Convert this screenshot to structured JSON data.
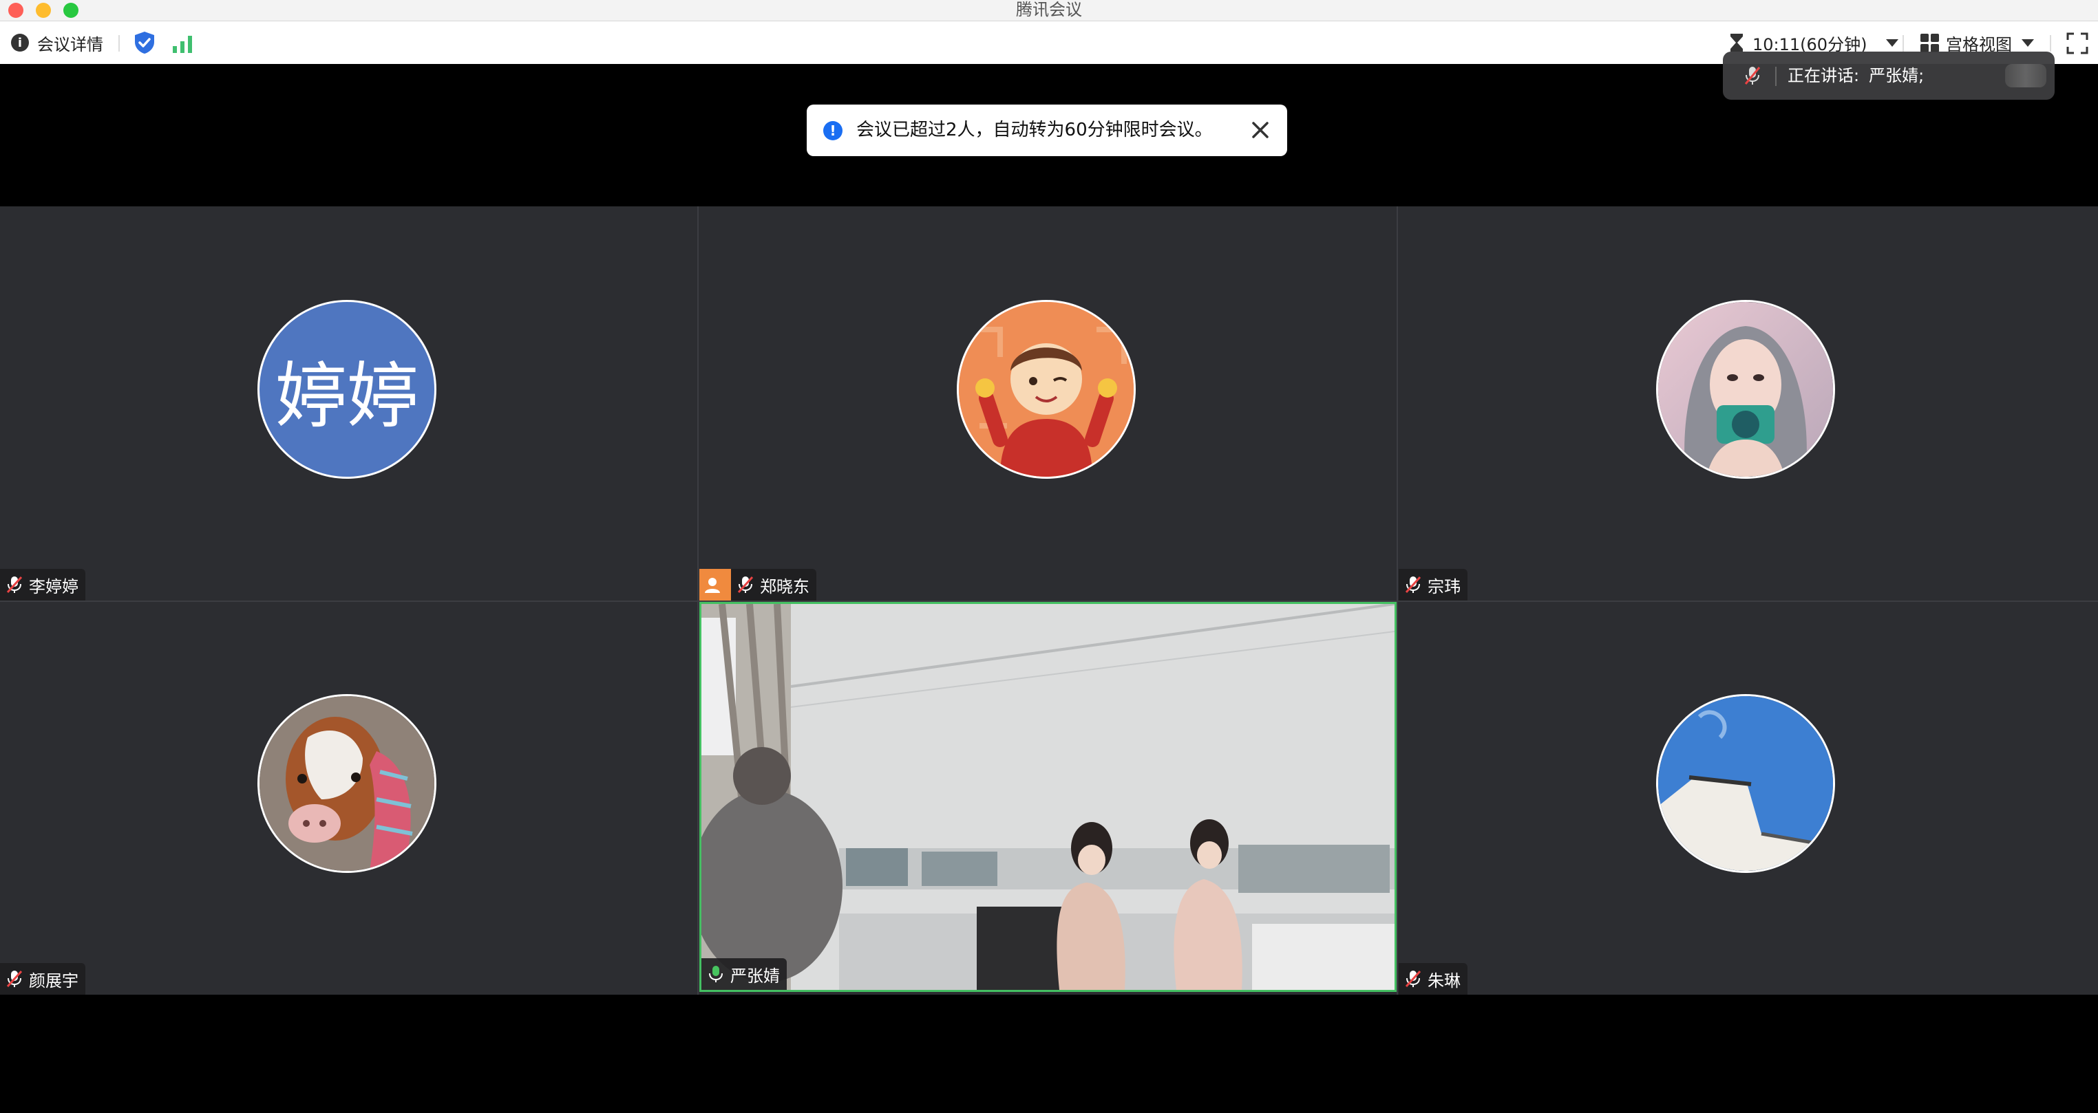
{
  "window": {
    "title": "腾讯会议"
  },
  "toolbar": {
    "meeting_info_label": "会议详情",
    "timer_label": "10:11(60分钟)",
    "view_label": "宫格视图"
  },
  "speaking_bar": {
    "prefix": "正在讲话:",
    "speaker": "严张婧;"
  },
  "toast": {
    "message": "会议已超过2人，自动转为60分钟限时会议。"
  },
  "participants": [
    {
      "name": "李婷婷",
      "avatar_text": "婷婷",
      "mic": "muted",
      "avatar_color": "#4f76c0"
    },
    {
      "name": "郑晓东",
      "mic": "muted",
      "host_badge": true
    },
    {
      "name": "宗玮",
      "mic": "muted"
    },
    {
      "name": "颜展宇",
      "mic": "muted"
    },
    {
      "name": "严张婧",
      "mic": "on",
      "video": true,
      "active_speaker": true
    },
    {
      "name": "朱琳",
      "mic": "muted"
    }
  ],
  "colors": {
    "accent_blue": "#1a6ef2",
    "speaker_border": "#44c062",
    "host_badge": "#f08a3e",
    "tile_bg": "#2c2d31"
  }
}
